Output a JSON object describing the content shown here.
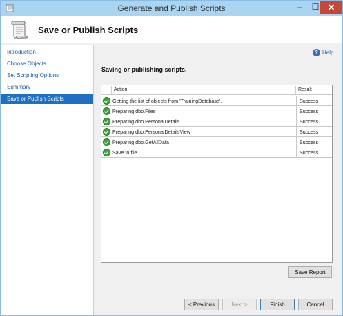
{
  "window": {
    "title": "Generate and Publish Scripts",
    "minimize_label": "–",
    "maximize_label": "☐",
    "close_label": "✕"
  },
  "header": {
    "title": "Save or Publish Scripts"
  },
  "sidebar": {
    "items": [
      {
        "label": "Introduction"
      },
      {
        "label": "Choose Objects"
      },
      {
        "label": "Set Scripting Options"
      },
      {
        "label": "Summary"
      },
      {
        "label": "Save or Publish Scripts"
      }
    ],
    "active_index": 4
  },
  "main": {
    "help_label": "Help",
    "help_icon": "help-icon",
    "section_title": "Saving or publishing scripts.",
    "columns": {
      "action": "Action",
      "result": "Result"
    },
    "rows": [
      {
        "action": "Getting the list of objects from 'TrainingDatabase'.",
        "result": "Success"
      },
      {
        "action": "Preparing dbo.Files",
        "result": "Success"
      },
      {
        "action": "Preparing dbo.PersonalDetails",
        "result": "Success"
      },
      {
        "action": "Preparing dbo.PersonalDetailsView",
        "result": "Success"
      },
      {
        "action": "Preparing dbo.GetAllData",
        "result": "Success"
      },
      {
        "action": "Save to file",
        "result": "Success"
      }
    ],
    "save_report_label": "Save Report"
  },
  "footer": {
    "previous_label": "< Previous",
    "next_label": "Next >",
    "finish_label": "Finish",
    "cancel_label": "Cancel"
  },
  "colors": {
    "titlebar": "#a9d4f2",
    "accent": "#1f6fc2",
    "close": "#c7463a",
    "success": "#3aa23a"
  }
}
